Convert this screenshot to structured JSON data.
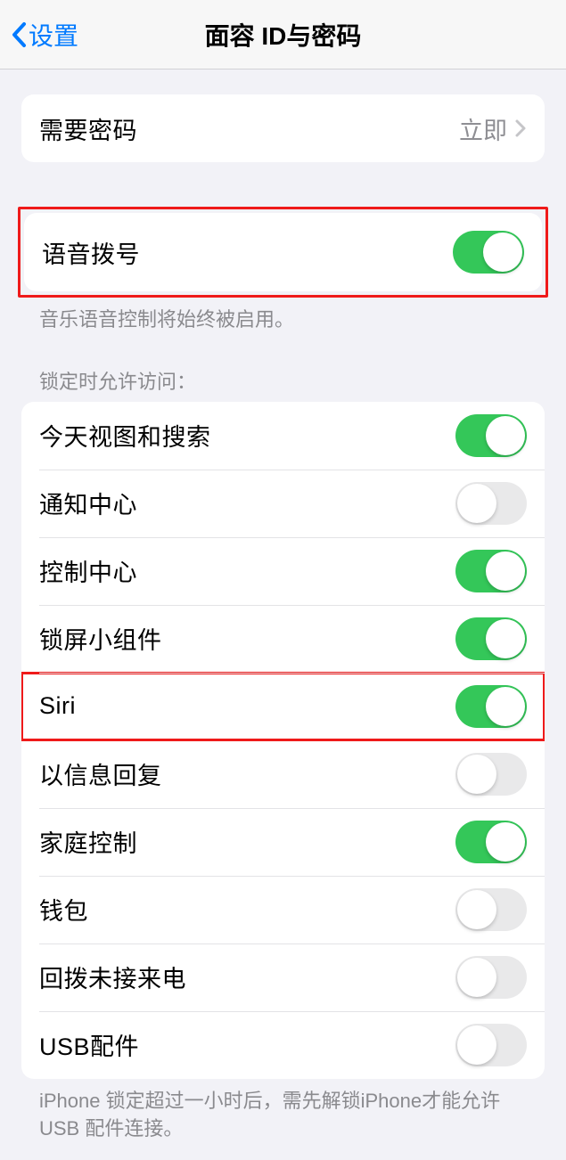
{
  "nav": {
    "back_label": "设置",
    "title": "面容 ID与密码"
  },
  "passcode_row": {
    "label": "需要密码",
    "value": "立即"
  },
  "voice_dial": {
    "label": "语音拨号",
    "footer": "音乐语音控制将始终被启用。"
  },
  "lock_access": {
    "header": "锁定时允许访问：",
    "items": [
      {
        "label": "今天视图和搜索",
        "on": true
      },
      {
        "label": "通知中心",
        "on": false
      },
      {
        "label": "控制中心",
        "on": true
      },
      {
        "label": "锁屏小组件",
        "on": true
      },
      {
        "label": "Siri",
        "on": true
      },
      {
        "label": "以信息回复",
        "on": false
      },
      {
        "label": "家庭控制",
        "on": true
      },
      {
        "label": "钱包",
        "on": false
      },
      {
        "label": "回拨未接来电",
        "on": false
      },
      {
        "label": "USB配件",
        "on": false
      }
    ],
    "footer": "iPhone 锁定超过一小时后，需先解锁iPhone才能允许 USB 配件连接。"
  }
}
